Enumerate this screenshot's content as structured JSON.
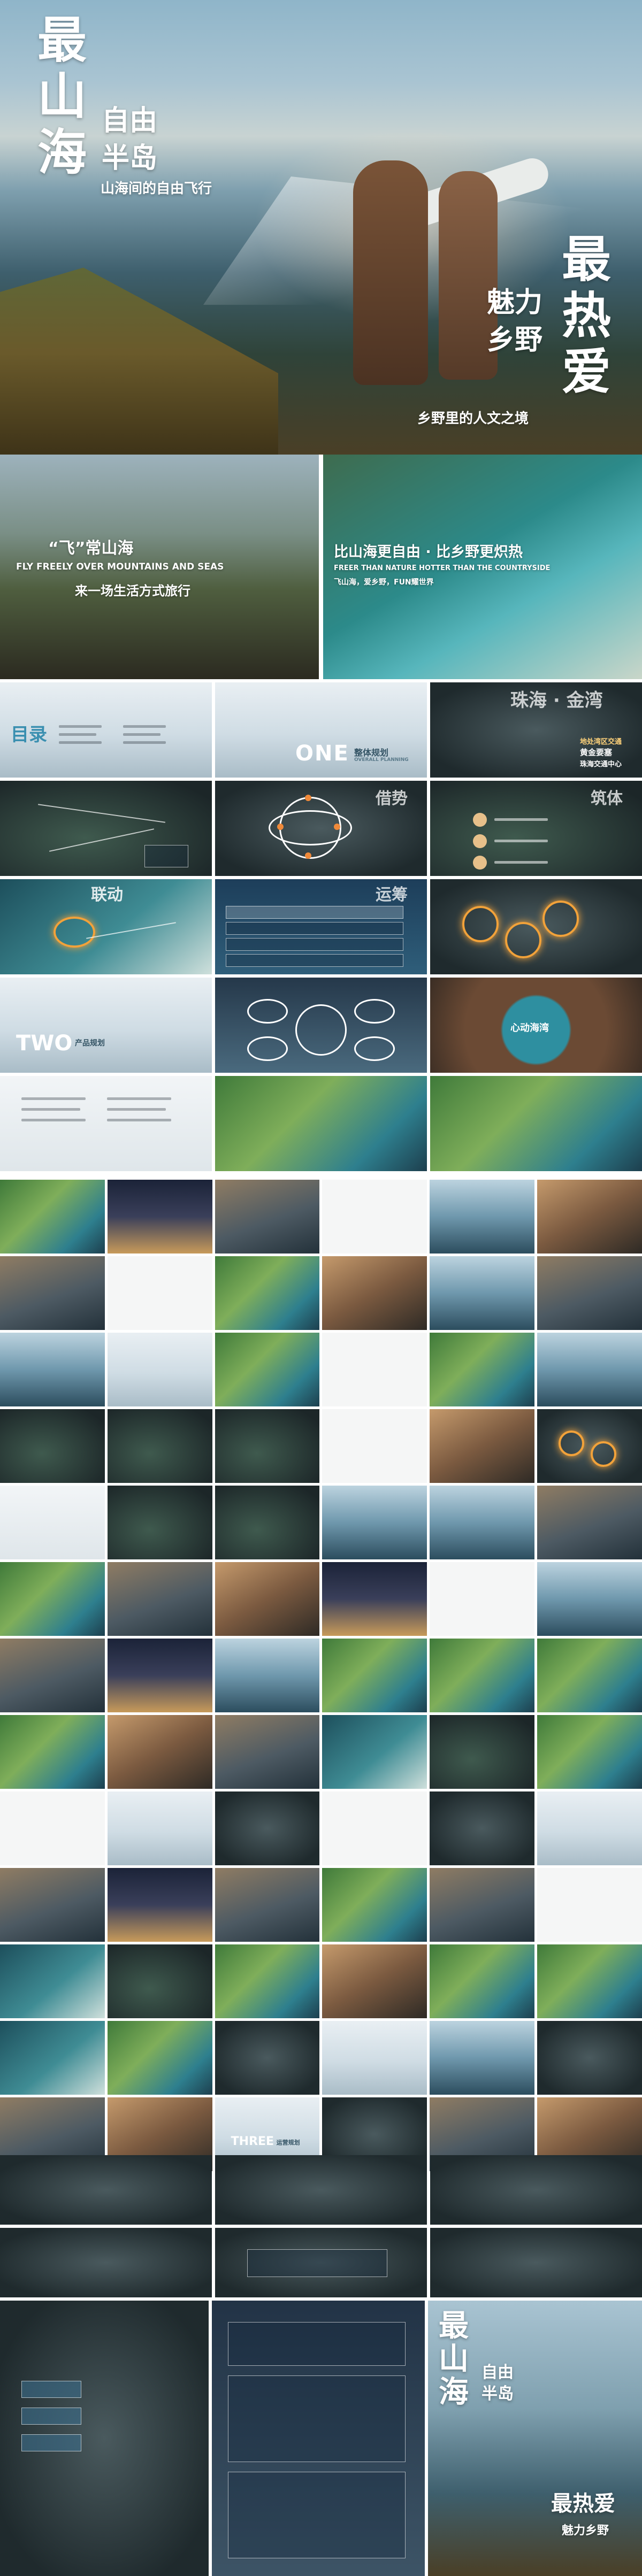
{
  "hero": {
    "title_chars": [
      "最",
      "山",
      "海"
    ],
    "subtitle_1": "自由",
    "subtitle_2": "半岛",
    "tagline": "山海间的自由飞行",
    "right_title_1": "最",
    "right_title_2": "热",
    "right_title_3": "爱",
    "right_sub_1": "魅力",
    "right_sub_2": "乡野",
    "right_tagline": "乡野里的人文之境"
  },
  "row2": {
    "left_quote": "“飞”常山海",
    "left_en": "FLY FREELY OVER MOUNTAINS AND SEAS",
    "left_cn": "来一场生活方式旅行",
    "right_title": "比山海更自由 · 比乡野更炽热",
    "right_en": "FREER THAN NATURE HOTTER THAN THE COUNTRYSIDE",
    "right_cn": "飞山海，爱乡野，FUN耀世界"
  },
  "slides": {
    "toc": "目录",
    "one": "ONE",
    "one_cn": "整体规划",
    "one_en": "OVERALL PLANNING",
    "zhuhai": "珠海 · 金湾",
    "jieshi": "借势",
    "zhuti": "筑体",
    "liandong": "联动",
    "yunchou": "运筹",
    "two": "TWO",
    "two_cn": "产品规划",
    "heart": "心动海湾",
    "three": "THREE",
    "three_cn": "运营规划",
    "traffic_1": "地处湾区交通",
    "traffic_2": "黄金要塞",
    "traffic_3": "珠海交通中心"
  },
  "end": {
    "title_chars": [
      "最",
      "山",
      "海"
    ],
    "subtitle_1": "自由",
    "subtitle_2": "半岛",
    "right_1": "最热爱",
    "right_sub": "魅力乡野"
  }
}
